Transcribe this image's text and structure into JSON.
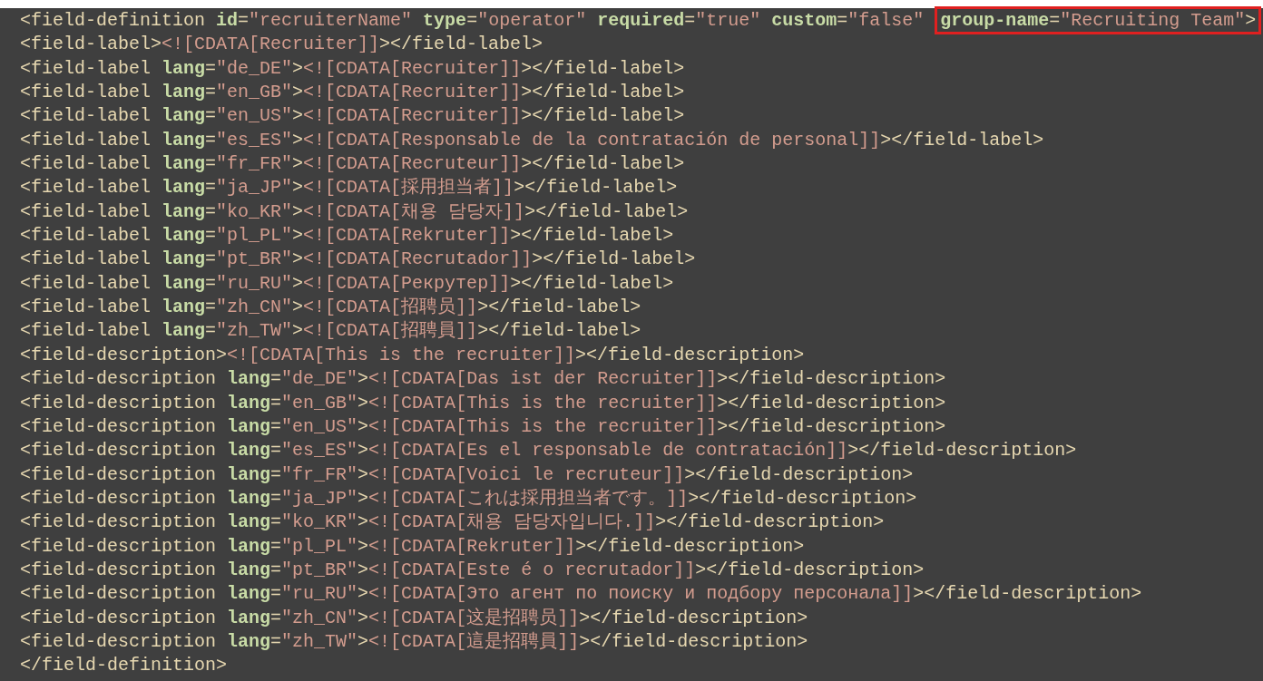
{
  "editor": {
    "lines": [
      {
        "tokens": [
          {
            "kind": "tag",
            "text": "<field-definition "
          },
          {
            "kind": "attr",
            "text": "id"
          },
          {
            "kind": "tag",
            "text": "="
          },
          {
            "kind": "value",
            "text": "\"recruiterName\" "
          },
          {
            "kind": "attr",
            "text": "type"
          },
          {
            "kind": "tag",
            "text": "="
          },
          {
            "kind": "value",
            "text": "\"operator\" "
          },
          {
            "kind": "attr",
            "text": "required"
          },
          {
            "kind": "tag",
            "text": "="
          },
          {
            "kind": "value",
            "text": "\"true\" "
          },
          {
            "kind": "attr",
            "text": "custom"
          },
          {
            "kind": "tag",
            "text": "="
          },
          {
            "kind": "value",
            "text": "\"false\" "
          }
        ],
        "boxed_tokens": [
          {
            "kind": "attr",
            "text": "group-name"
          },
          {
            "kind": "tag",
            "text": "="
          },
          {
            "kind": "value",
            "text": "\"Recruiting Team\""
          },
          {
            "kind": "tag",
            "text": ">"
          }
        ]
      },
      {
        "tokens": [
          {
            "kind": "tag",
            "text": "<field-label>"
          },
          {
            "kind": "cdata",
            "text": "<![CDATA[Recruiter]]"
          },
          {
            "kind": "tag",
            "text": "></field-label>"
          }
        ]
      },
      {
        "tokens": [
          {
            "kind": "tag",
            "text": "<field-label "
          },
          {
            "kind": "attr",
            "text": "lang"
          },
          {
            "kind": "tag",
            "text": "="
          },
          {
            "kind": "value",
            "text": "\"de_DE\""
          },
          {
            "kind": "tag",
            "text": ">"
          },
          {
            "kind": "cdata",
            "text": "<![CDATA[Recruiter]]"
          },
          {
            "kind": "tag",
            "text": "></field-label>"
          }
        ]
      },
      {
        "tokens": [
          {
            "kind": "tag",
            "text": "<field-label "
          },
          {
            "kind": "attr",
            "text": "lang"
          },
          {
            "kind": "tag",
            "text": "="
          },
          {
            "kind": "value",
            "text": "\"en_GB\""
          },
          {
            "kind": "tag",
            "text": ">"
          },
          {
            "kind": "cdata",
            "text": "<![CDATA[Recruiter]]"
          },
          {
            "kind": "tag",
            "text": "></field-label>"
          }
        ]
      },
      {
        "tokens": [
          {
            "kind": "tag",
            "text": "<field-label "
          },
          {
            "kind": "attr",
            "text": "lang"
          },
          {
            "kind": "tag",
            "text": "="
          },
          {
            "kind": "value",
            "text": "\"en_US\""
          },
          {
            "kind": "tag",
            "text": ">"
          },
          {
            "kind": "cdata",
            "text": "<![CDATA[Recruiter]]"
          },
          {
            "kind": "tag",
            "text": "></field-label>"
          }
        ]
      },
      {
        "tokens": [
          {
            "kind": "tag",
            "text": "<field-label "
          },
          {
            "kind": "attr",
            "text": "lang"
          },
          {
            "kind": "tag",
            "text": "="
          },
          {
            "kind": "value",
            "text": "\"es_ES\""
          },
          {
            "kind": "tag",
            "text": ">"
          },
          {
            "kind": "cdata",
            "text": "<![CDATA[Responsable de la contratación de personal]]"
          },
          {
            "kind": "tag",
            "text": "></field-label>"
          }
        ]
      },
      {
        "tokens": [
          {
            "kind": "tag",
            "text": "<field-label "
          },
          {
            "kind": "attr",
            "text": "lang"
          },
          {
            "kind": "tag",
            "text": "="
          },
          {
            "kind": "value",
            "text": "\"fr_FR\""
          },
          {
            "kind": "tag",
            "text": ">"
          },
          {
            "kind": "cdata",
            "text": "<![CDATA[Recruteur]]"
          },
          {
            "kind": "tag",
            "text": "></field-label>"
          }
        ]
      },
      {
        "tokens": [
          {
            "kind": "tag",
            "text": "<field-label "
          },
          {
            "kind": "attr",
            "text": "lang"
          },
          {
            "kind": "tag",
            "text": "="
          },
          {
            "kind": "value",
            "text": "\"ja_JP\""
          },
          {
            "kind": "tag",
            "text": ">"
          },
          {
            "kind": "cdata",
            "text": "<![CDATA[採用担当者]]"
          },
          {
            "kind": "tag",
            "text": "></field-label>"
          }
        ]
      },
      {
        "tokens": [
          {
            "kind": "tag",
            "text": "<field-label "
          },
          {
            "kind": "attr",
            "text": "lang"
          },
          {
            "kind": "tag",
            "text": "="
          },
          {
            "kind": "value",
            "text": "\"ko_KR\""
          },
          {
            "kind": "tag",
            "text": ">"
          },
          {
            "kind": "cdata",
            "text": "<![CDATA[채용 담당자]]"
          },
          {
            "kind": "tag",
            "text": "></field-label>"
          }
        ]
      },
      {
        "tokens": [
          {
            "kind": "tag",
            "text": "<field-label "
          },
          {
            "kind": "attr",
            "text": "lang"
          },
          {
            "kind": "tag",
            "text": "="
          },
          {
            "kind": "value",
            "text": "\"pl_PL\""
          },
          {
            "kind": "tag",
            "text": ">"
          },
          {
            "kind": "cdata",
            "text": "<![CDATA[Rekruter]]"
          },
          {
            "kind": "tag",
            "text": "></field-label>"
          }
        ]
      },
      {
        "tokens": [
          {
            "kind": "tag",
            "text": "<field-label "
          },
          {
            "kind": "attr",
            "text": "lang"
          },
          {
            "kind": "tag",
            "text": "="
          },
          {
            "kind": "value",
            "text": "\"pt_BR\""
          },
          {
            "kind": "tag",
            "text": ">"
          },
          {
            "kind": "cdata",
            "text": "<![CDATA[Recrutador]]"
          },
          {
            "kind": "tag",
            "text": "></field-label>"
          }
        ]
      },
      {
        "tokens": [
          {
            "kind": "tag",
            "text": "<field-label "
          },
          {
            "kind": "attr",
            "text": "lang"
          },
          {
            "kind": "tag",
            "text": "="
          },
          {
            "kind": "value",
            "text": "\"ru_RU\""
          },
          {
            "kind": "tag",
            "text": ">"
          },
          {
            "kind": "cdata",
            "text": "<![CDATA[Рекрутер]]"
          },
          {
            "kind": "tag",
            "text": "></field-label>"
          }
        ]
      },
      {
        "tokens": [
          {
            "kind": "tag",
            "text": "<field-label "
          },
          {
            "kind": "attr",
            "text": "lang"
          },
          {
            "kind": "tag",
            "text": "="
          },
          {
            "kind": "value",
            "text": "\"zh_CN\""
          },
          {
            "kind": "tag",
            "text": ">"
          },
          {
            "kind": "cdata",
            "text": "<![CDATA[招聘员]]"
          },
          {
            "kind": "tag",
            "text": "></field-label>"
          }
        ]
      },
      {
        "tokens": [
          {
            "kind": "tag",
            "text": "<field-label "
          },
          {
            "kind": "attr",
            "text": "lang"
          },
          {
            "kind": "tag",
            "text": "="
          },
          {
            "kind": "value",
            "text": "\"zh_TW\""
          },
          {
            "kind": "tag",
            "text": ">"
          },
          {
            "kind": "cdata",
            "text": "<![CDATA[招聘員]]"
          },
          {
            "kind": "tag",
            "text": "></field-label>"
          }
        ]
      },
      {
        "tokens": [
          {
            "kind": "tag",
            "text": "<field-description>"
          },
          {
            "kind": "cdata",
            "text": "<![CDATA[This is the recruiter]]"
          },
          {
            "kind": "tag",
            "text": "></field-description>"
          }
        ]
      },
      {
        "tokens": [
          {
            "kind": "tag",
            "text": "<field-description "
          },
          {
            "kind": "attr",
            "text": "lang"
          },
          {
            "kind": "tag",
            "text": "="
          },
          {
            "kind": "value",
            "text": "\"de_DE\""
          },
          {
            "kind": "tag",
            "text": ">"
          },
          {
            "kind": "cdata",
            "text": "<![CDATA[Das ist der Recruiter]]"
          },
          {
            "kind": "tag",
            "text": "></field-description>"
          }
        ]
      },
      {
        "tokens": [
          {
            "kind": "tag",
            "text": "<field-description "
          },
          {
            "kind": "attr",
            "text": "lang"
          },
          {
            "kind": "tag",
            "text": "="
          },
          {
            "kind": "value",
            "text": "\"en_GB\""
          },
          {
            "kind": "tag",
            "text": ">"
          },
          {
            "kind": "cdata",
            "text": "<![CDATA[This is the recruiter]]"
          },
          {
            "kind": "tag",
            "text": "></field-description>"
          }
        ]
      },
      {
        "tokens": [
          {
            "kind": "tag",
            "text": "<field-description "
          },
          {
            "kind": "attr",
            "text": "lang"
          },
          {
            "kind": "tag",
            "text": "="
          },
          {
            "kind": "value",
            "text": "\"en_US\""
          },
          {
            "kind": "tag",
            "text": ">"
          },
          {
            "kind": "cdata",
            "text": "<![CDATA[This is the recruiter]]"
          },
          {
            "kind": "tag",
            "text": "></field-description>"
          }
        ]
      },
      {
        "tokens": [
          {
            "kind": "tag",
            "text": "<field-description "
          },
          {
            "kind": "attr",
            "text": "lang"
          },
          {
            "kind": "tag",
            "text": "="
          },
          {
            "kind": "value",
            "text": "\"es_ES\""
          },
          {
            "kind": "tag",
            "text": ">"
          },
          {
            "kind": "cdata",
            "text": "<![CDATA[Es el responsable de contratación]]"
          },
          {
            "kind": "tag",
            "text": "></field-description>"
          }
        ]
      },
      {
        "tokens": [
          {
            "kind": "tag",
            "text": "<field-description "
          },
          {
            "kind": "attr",
            "text": "lang"
          },
          {
            "kind": "tag",
            "text": "="
          },
          {
            "kind": "value",
            "text": "\"fr_FR\""
          },
          {
            "kind": "tag",
            "text": ">"
          },
          {
            "kind": "cdata",
            "text": "<![CDATA[Voici le recruteur]]"
          },
          {
            "kind": "tag",
            "text": "></field-description>"
          }
        ]
      },
      {
        "tokens": [
          {
            "kind": "tag",
            "text": "<field-description "
          },
          {
            "kind": "attr",
            "text": "lang"
          },
          {
            "kind": "tag",
            "text": "="
          },
          {
            "kind": "value",
            "text": "\"ja_JP\""
          },
          {
            "kind": "tag",
            "text": ">"
          },
          {
            "kind": "cdata",
            "text": "<![CDATA[これは採用担当者です。]]"
          },
          {
            "kind": "tag",
            "text": "></field-description>"
          }
        ]
      },
      {
        "tokens": [
          {
            "kind": "tag",
            "text": "<field-description "
          },
          {
            "kind": "attr",
            "text": "lang"
          },
          {
            "kind": "tag",
            "text": "="
          },
          {
            "kind": "value",
            "text": "\"ko_KR\""
          },
          {
            "kind": "tag",
            "text": ">"
          },
          {
            "kind": "cdata",
            "text": "<![CDATA[채용 담당자입니다.]]"
          },
          {
            "kind": "tag",
            "text": "></field-description>"
          }
        ]
      },
      {
        "tokens": [
          {
            "kind": "tag",
            "text": "<field-description "
          },
          {
            "kind": "attr",
            "text": "lang"
          },
          {
            "kind": "tag",
            "text": "="
          },
          {
            "kind": "value",
            "text": "\"pl_PL\""
          },
          {
            "kind": "tag",
            "text": ">"
          },
          {
            "kind": "cdata",
            "text": "<![CDATA[Rekruter]]"
          },
          {
            "kind": "tag",
            "text": "></field-description>"
          }
        ]
      },
      {
        "tokens": [
          {
            "kind": "tag",
            "text": "<field-description "
          },
          {
            "kind": "attr",
            "text": "lang"
          },
          {
            "kind": "tag",
            "text": "="
          },
          {
            "kind": "value",
            "text": "\"pt_BR\""
          },
          {
            "kind": "tag",
            "text": ">"
          },
          {
            "kind": "cdata",
            "text": "<![CDATA[Este é o recrutador]]"
          },
          {
            "kind": "tag",
            "text": "></field-description>"
          }
        ]
      },
      {
        "tokens": [
          {
            "kind": "tag",
            "text": "<field-description "
          },
          {
            "kind": "attr",
            "text": "lang"
          },
          {
            "kind": "tag",
            "text": "="
          },
          {
            "kind": "value",
            "text": "\"ru_RU\""
          },
          {
            "kind": "tag",
            "text": ">"
          },
          {
            "kind": "cdata",
            "text": "<![CDATA[Это агент по поиску и подбору персонала]]"
          },
          {
            "kind": "tag",
            "text": "></field-description>"
          }
        ]
      },
      {
        "tokens": [
          {
            "kind": "tag",
            "text": "<field-description "
          },
          {
            "kind": "attr",
            "text": "lang"
          },
          {
            "kind": "tag",
            "text": "="
          },
          {
            "kind": "value",
            "text": "\"zh_CN\""
          },
          {
            "kind": "tag",
            "text": ">"
          },
          {
            "kind": "cdata",
            "text": "<![CDATA[这是招聘员]]"
          },
          {
            "kind": "tag",
            "text": "></field-description>"
          }
        ]
      },
      {
        "tokens": [
          {
            "kind": "tag",
            "text": "<field-description "
          },
          {
            "kind": "attr",
            "text": "lang"
          },
          {
            "kind": "tag",
            "text": "="
          },
          {
            "kind": "value",
            "text": "\"zh_TW\""
          },
          {
            "kind": "tag",
            "text": ">"
          },
          {
            "kind": "cdata",
            "text": "<![CDATA[這是招聘員]]"
          },
          {
            "kind": "tag",
            "text": "></field-description>"
          }
        ]
      },
      {
        "tokens": [
          {
            "kind": "tag",
            "text": "</field-definition>"
          }
        ]
      }
    ]
  }
}
